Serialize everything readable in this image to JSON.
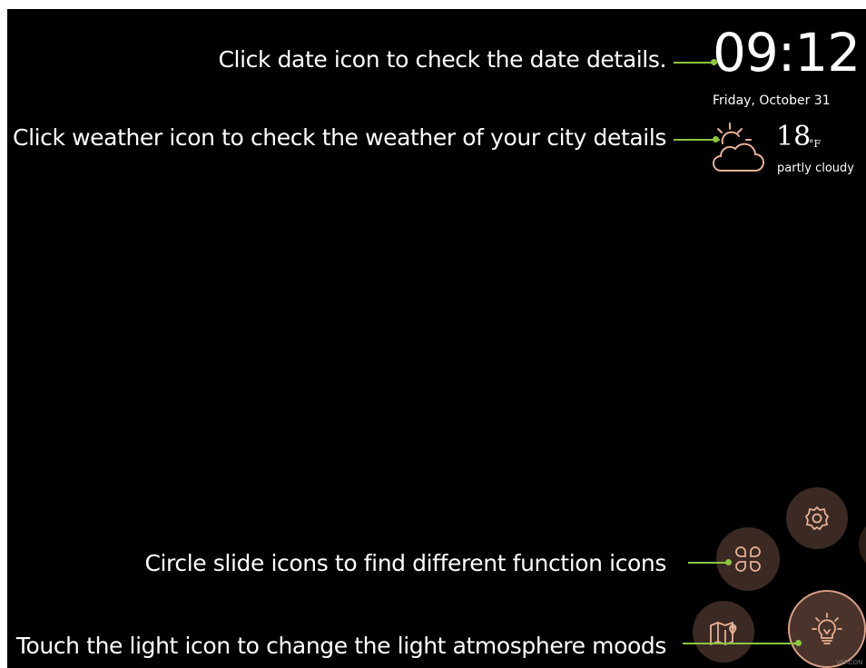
{
  "annotations": {
    "date": "Click date icon to check the date details.",
    "weather": "Click weather icon to check the weather of your city details",
    "circle": "Circle slide icons to find different function icons",
    "light": "Touch the light icon to change the light atmosphere moods"
  },
  "clock": {
    "time": "09:12",
    "date": "Friday, October 31"
  },
  "weather": {
    "temperature": "18",
    "unit": "°F",
    "condition": "partly cloudy",
    "icon": "partly-cloudy-icon"
  },
  "menu_icons": [
    "settings-icon",
    "apps-icon",
    "map-icon",
    "light-bulb-icon"
  ],
  "brand": "VERCON",
  "colors": {
    "background": "#000000",
    "accent_line": "#8cc63f",
    "icon_stroke": "#e8b196",
    "circle_fill": "#3a2a23"
  }
}
